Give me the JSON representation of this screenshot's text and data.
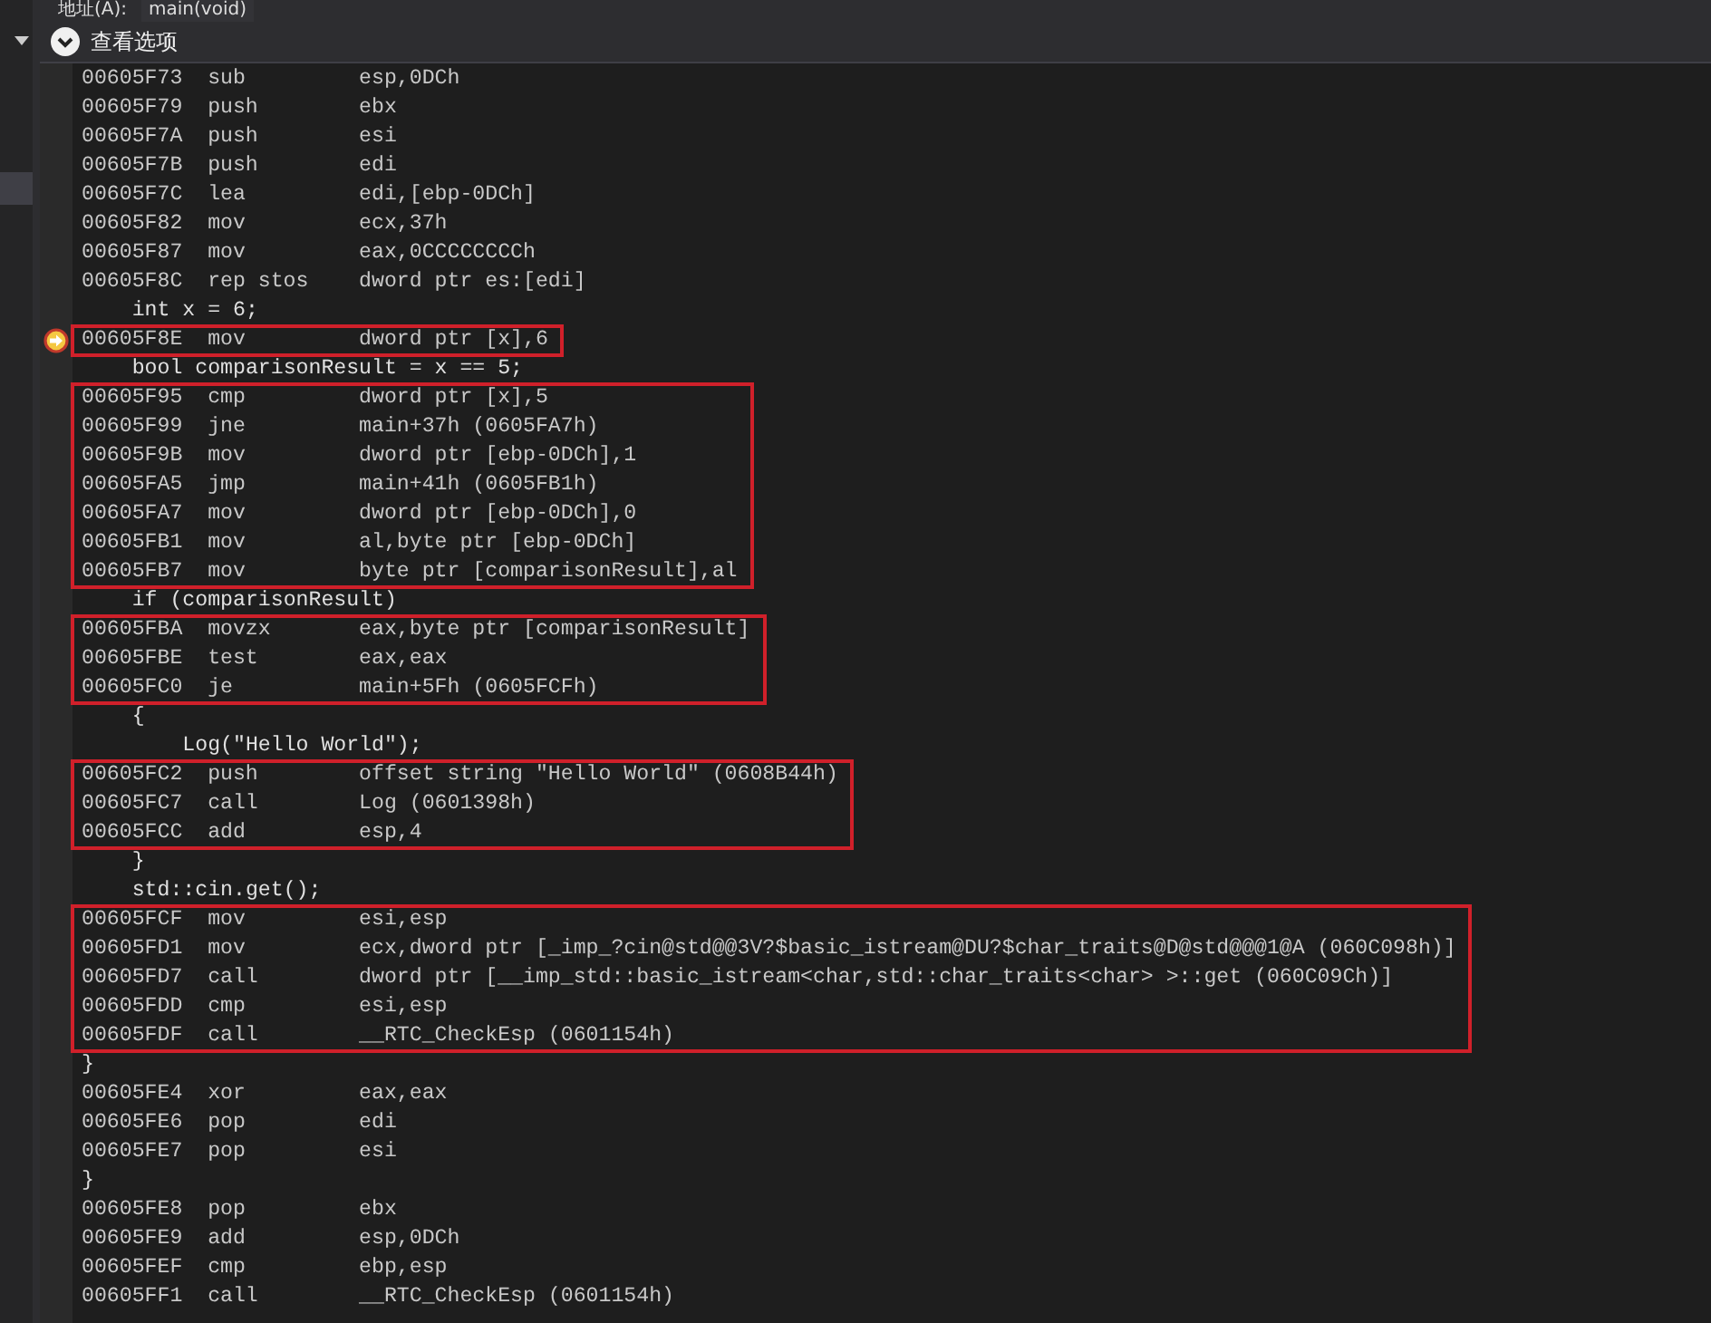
{
  "address_bar": {
    "label": "地址(A):",
    "value": "main(void)"
  },
  "view_options": {
    "label": "查看选项",
    "expanded": true
  },
  "blocks": [
    {
      "kind": "asm",
      "highlighted": false,
      "rows": [
        {
          "address": "00605F73",
          "mnemonic": "sub",
          "operands": "esp,0DCh",
          "current": false
        },
        {
          "address": "00605F79",
          "mnemonic": "push",
          "operands": "ebx",
          "current": false
        },
        {
          "address": "00605F7A",
          "mnemonic": "push",
          "operands": "esi",
          "current": false
        },
        {
          "address": "00605F7B",
          "mnemonic": "push",
          "operands": "edi",
          "current": false
        },
        {
          "address": "00605F7C",
          "mnemonic": "lea",
          "operands": "edi,[ebp-0DCh]",
          "current": false
        },
        {
          "address": "00605F82",
          "mnemonic": "mov",
          "operands": "ecx,37h",
          "current": false
        },
        {
          "address": "00605F87",
          "mnemonic": "mov",
          "operands": "eax,0CCCCCCCCh",
          "current": false
        },
        {
          "address": "00605F8C",
          "mnemonic": "rep stos",
          "operands": "dword ptr es:[edi]",
          "current": false
        }
      ]
    },
    {
      "kind": "source",
      "text": "    int x = 6;"
    },
    {
      "kind": "asm",
      "highlighted": true,
      "rows": [
        {
          "address": "00605F8E",
          "mnemonic": "mov",
          "operands": "dword ptr [x],6",
          "current": true
        }
      ]
    },
    {
      "kind": "source",
      "text": "    bool comparisonResult = x == 5;"
    },
    {
      "kind": "asm",
      "highlighted": true,
      "rows": [
        {
          "address": "00605F95",
          "mnemonic": "cmp",
          "operands": "dword ptr [x],5",
          "current": false
        },
        {
          "address": "00605F99",
          "mnemonic": "jne",
          "operands": "main+37h (0605FA7h)",
          "current": false
        },
        {
          "address": "00605F9B",
          "mnemonic": "mov",
          "operands": "dword ptr [ebp-0DCh],1",
          "current": false
        },
        {
          "address": "00605FA5",
          "mnemonic": "jmp",
          "operands": "main+41h (0605FB1h)",
          "current": false
        },
        {
          "address": "00605FA7",
          "mnemonic": "mov",
          "operands": "dword ptr [ebp-0DCh],0",
          "current": false
        },
        {
          "address": "00605FB1",
          "mnemonic": "mov",
          "operands": "al,byte ptr [ebp-0DCh]",
          "current": false
        },
        {
          "address": "00605FB7",
          "mnemonic": "mov",
          "operands": "byte ptr [comparisonResult],al",
          "current": false
        }
      ]
    },
    {
      "kind": "source",
      "text": "    if (comparisonResult)"
    },
    {
      "kind": "asm",
      "highlighted": true,
      "rows": [
        {
          "address": "00605FBA",
          "mnemonic": "movzx",
          "operands": "eax,byte ptr [comparisonResult]",
          "current": false
        },
        {
          "address": "00605FBE",
          "mnemonic": "test",
          "operands": "eax,eax",
          "current": false
        },
        {
          "address": "00605FC0",
          "mnemonic": "je",
          "operands": "main+5Fh (0605FCFh)",
          "current": false
        }
      ]
    },
    {
      "kind": "source",
      "text": "    {"
    },
    {
      "kind": "source",
      "text": "        Log(\"Hello World\");"
    },
    {
      "kind": "asm",
      "highlighted": true,
      "rows": [
        {
          "address": "00605FC2",
          "mnemonic": "push",
          "operands": "offset string \"Hello World\" (0608B44h)",
          "current": false
        },
        {
          "address": "00605FC7",
          "mnemonic": "call",
          "operands": "Log (0601398h)",
          "current": false
        },
        {
          "address": "00605FCC",
          "mnemonic": "add",
          "operands": "esp,4",
          "current": false
        }
      ]
    },
    {
      "kind": "source",
      "text": "    }"
    },
    {
      "kind": "source",
      "text": "    std::cin.get();"
    },
    {
      "kind": "asm",
      "highlighted": true,
      "rows": [
        {
          "address": "00605FCF",
          "mnemonic": "mov",
          "operands": "esi,esp",
          "current": false
        },
        {
          "address": "00605FD1",
          "mnemonic": "mov",
          "operands": "ecx,dword ptr [_imp_?cin@std@@3V?$basic_istream@DU?$char_traits@D@std@@@1@A (060C098h)]",
          "current": false
        },
        {
          "address": "00605FD7",
          "mnemonic": "call",
          "operands": "dword ptr [__imp_std::basic_istream<char,std::char_traits<char> >::get (060C09Ch)]",
          "current": false
        },
        {
          "address": "00605FDD",
          "mnemonic": "cmp",
          "operands": "esi,esp",
          "current": false
        },
        {
          "address": "00605FDF",
          "mnemonic": "call",
          "operands": "__RTC_CheckEsp (0601154h)",
          "current": false
        }
      ]
    },
    {
      "kind": "source",
      "text": "}"
    },
    {
      "kind": "asm",
      "highlighted": false,
      "rows": [
        {
          "address": "00605FE4",
          "mnemonic": "xor",
          "operands": "eax,eax",
          "current": false
        },
        {
          "address": "00605FE6",
          "mnemonic": "pop",
          "operands": "edi",
          "current": false
        },
        {
          "address": "00605FE7",
          "mnemonic": "pop",
          "operands": "esi",
          "current": false
        }
      ]
    },
    {
      "kind": "source",
      "text": "}"
    },
    {
      "kind": "asm",
      "highlighted": false,
      "rows": [
        {
          "address": "00605FE8",
          "mnemonic": "pop",
          "operands": "ebx",
          "current": false
        },
        {
          "address": "00605FE9",
          "mnemonic": "add",
          "operands": "esp,0DCh",
          "current": false
        },
        {
          "address": "00605FEF",
          "mnemonic": "cmp",
          "operands": "ebp,esp",
          "current": false
        },
        {
          "address": "00605FF1",
          "mnemonic": "call",
          "operands": "__RTC_CheckEsp (0601154h)",
          "current": false
        }
      ]
    }
  ]
}
